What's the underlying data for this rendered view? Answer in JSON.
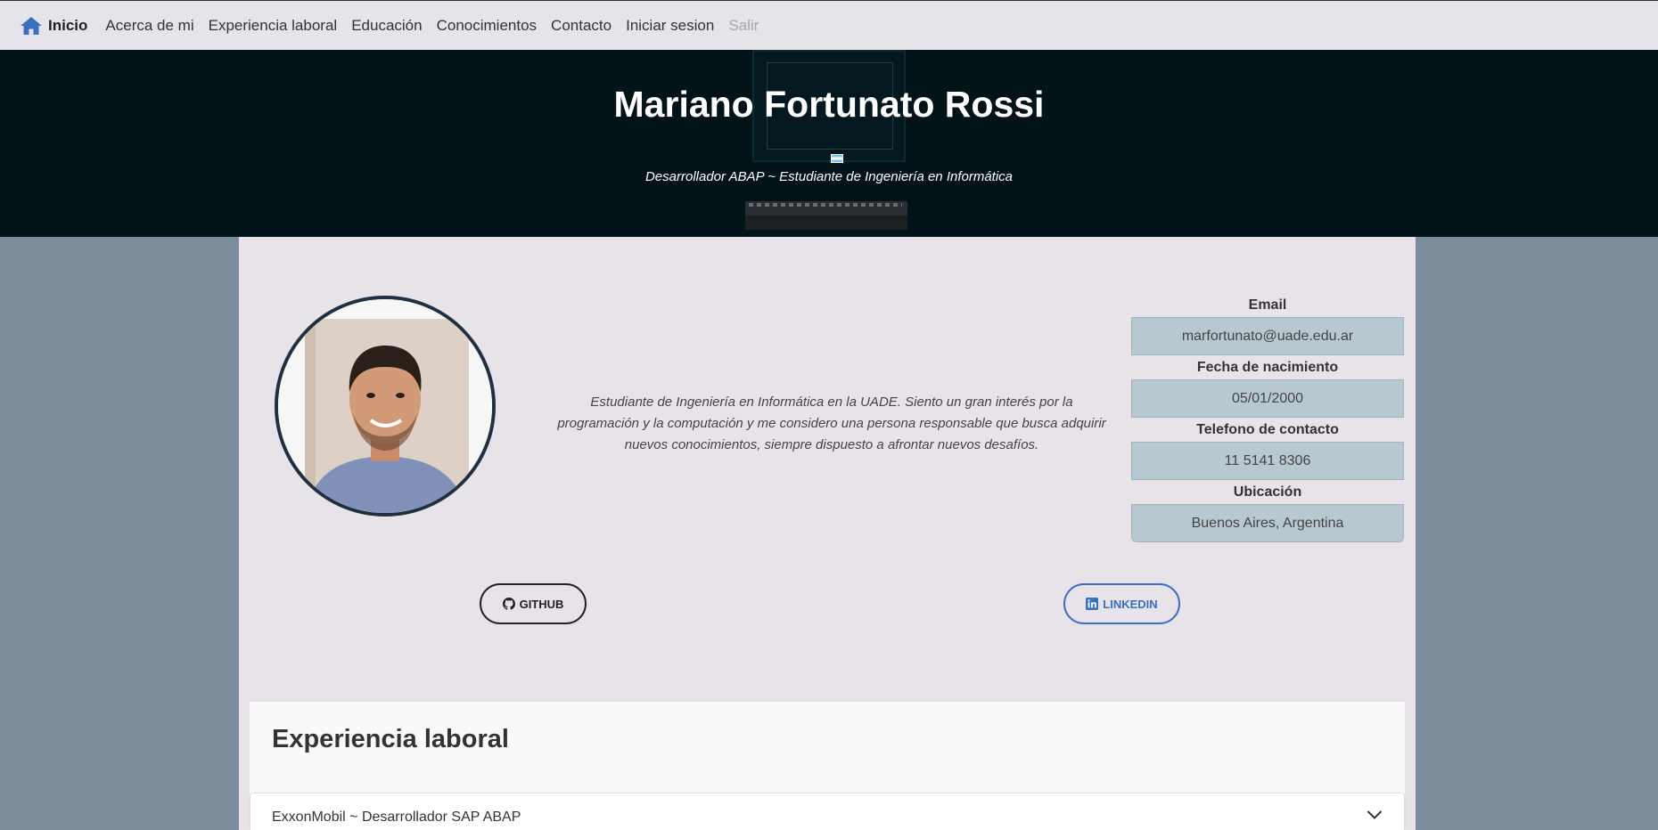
{
  "nav": {
    "brand": "Inicio",
    "items": [
      "Acerca de mi",
      "Experiencia laboral",
      "Educación",
      "Conocimientos",
      "Contacto",
      "Iniciar sesion"
    ],
    "disabled_item": "Salir"
  },
  "hero": {
    "title": "Mariano Fortunato Rossi",
    "subtitle": "Desarrollador ABAP ~ Estudiante de Ingeniería en Informática"
  },
  "profile": {
    "about": "Estudiante de Ingeniería en Informática en la UADE. Siento un gran interés por la programación y la computación y me considero una persona responsable que busca adquirir nuevos conocimientos, siempre dispuesto a afrontar nuevos desafíos.",
    "info": [
      {
        "label": "Email",
        "value": "marfortunato@uade.edu.ar"
      },
      {
        "label": "Fecha de nacimiento",
        "value": "05/01/2000"
      },
      {
        "label": "Telefono de contacto",
        "value": "11 5141 8306"
      },
      {
        "label": "Ubicación",
        "value": "Buenos Aires, Argentina"
      }
    ],
    "github_label": "GITHUB",
    "linkedin_label": "LINKEDIN"
  },
  "experience": {
    "title": "Experiencia laboral",
    "items": [
      {
        "label": "ExxonMobil ~ Desarrollador SAP ABAP"
      }
    ]
  },
  "colors": {
    "accent": "#3a6fc2",
    "hero_bg": "#031418",
    "page_bg": "#7b8d9a",
    "panel_bg": "#e8e3e9",
    "info_box": "#b7c8d1"
  },
  "icons": {
    "brand": "home-icon",
    "github": "github-icon",
    "linkedin": "linkedin-icon",
    "expand": "chevron-down-icon"
  }
}
